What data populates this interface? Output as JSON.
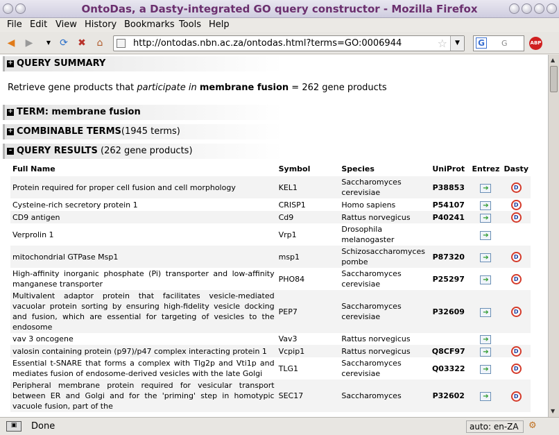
{
  "window": {
    "title": "OntoDas, a Dasty-integrated GO query constructor - Mozilla Firefox"
  },
  "menu": [
    "File",
    "Edit",
    "View",
    "History",
    "Bookmarks",
    "Tools",
    "Help"
  ],
  "navbar": {
    "url": "http://ontodas.nbn.ac.za/ontodas.html?terms=GO:0006944",
    "search_engine_letter": "G",
    "search_placeholder": "G",
    "abp_label": "ABP"
  },
  "summary_section": {
    "header": "QUERY SUMMARY",
    "text_prefix": "Retrieve gene products that ",
    "relation": "participate in",
    "term": "membrane fusion",
    "text_suffix": " = 262 gene products"
  },
  "term_section": {
    "header": "TERM: membrane fusion"
  },
  "combinable_section": {
    "header": "COMBINABLE TERMS",
    "count": "(1945 terms)"
  },
  "results_section": {
    "header": "QUERY RESULTS",
    "count": " (262 gene products)"
  },
  "table": {
    "columns": [
      "Full Name",
      "Symbol",
      "Species",
      "UniProt",
      "Entrez",
      "Dasty"
    ],
    "rows": [
      {
        "name": "Protein required for proper cell fusion and cell morphology",
        "symbol": "KEL1",
        "species": "Saccharomyces cerevisiae",
        "uniprot": "P38853",
        "dasty": true
      },
      {
        "name": "Cysteine-rich secretory protein 1",
        "symbol": "CRISP1",
        "species": "Homo sapiens",
        "uniprot": "P54107",
        "dasty": true
      },
      {
        "name": "CD9 antigen",
        "symbol": "Cd9",
        "species": "Rattus norvegicus",
        "uniprot": "P40241",
        "dasty": true
      },
      {
        "name": "Verprolin 1",
        "symbol": "Vrp1",
        "species": "Drosophila melanogaster",
        "uniprot": "",
        "dasty": false
      },
      {
        "name": "mitochondrial GTPase Msp1",
        "symbol": "msp1",
        "species": "Schizosaccharomyces pombe",
        "uniprot": "P87320",
        "dasty": true
      },
      {
        "name": "High-affinity inorganic phosphate (Pi) transporter and low-affinity manganese transporter",
        "symbol": "PHO84",
        "species": "Saccharomyces cerevisiae",
        "uniprot": "P25297",
        "dasty": true
      },
      {
        "name": "Multivalent adaptor protein that facilitates vesicle-mediated vacuolar protein sorting by ensuring high-fidelity vesicle docking and fusion, which are essential for targeting of vesicles to the endosome",
        "symbol": "PEP7",
        "species": "Saccharomyces cerevisiae",
        "uniprot": "P32609",
        "dasty": true
      },
      {
        "name": "vav 3 oncogene",
        "symbol": "Vav3",
        "species": "Rattus norvegicus",
        "uniprot": "",
        "dasty": false
      },
      {
        "name": "valosin containing protein (p97)/p47 complex interacting protein 1",
        "symbol": "Vcpip1",
        "species": "Rattus norvegicus",
        "uniprot": "Q8CF97",
        "dasty": true
      },
      {
        "name": "Essential t-SNARE that forms a complex with Tlg2p and Vti1p and mediates fusion of endosome-derived vesicles with the late Golgi",
        "symbol": "TLG1",
        "species": "Saccharomyces cerevisiae",
        "uniprot": "Q03322",
        "dasty": true
      },
      {
        "name": "Peripheral membrane protein required for vesicular transport between ER and Golgi and for the 'priming' step in homotypic vacuole fusion, part of the",
        "symbol": "SEC17",
        "species": "Saccharomyces",
        "uniprot": "P32602",
        "dasty": true
      }
    ]
  },
  "statusbar": {
    "status": "Done",
    "locale": "auto: en-ZA"
  }
}
